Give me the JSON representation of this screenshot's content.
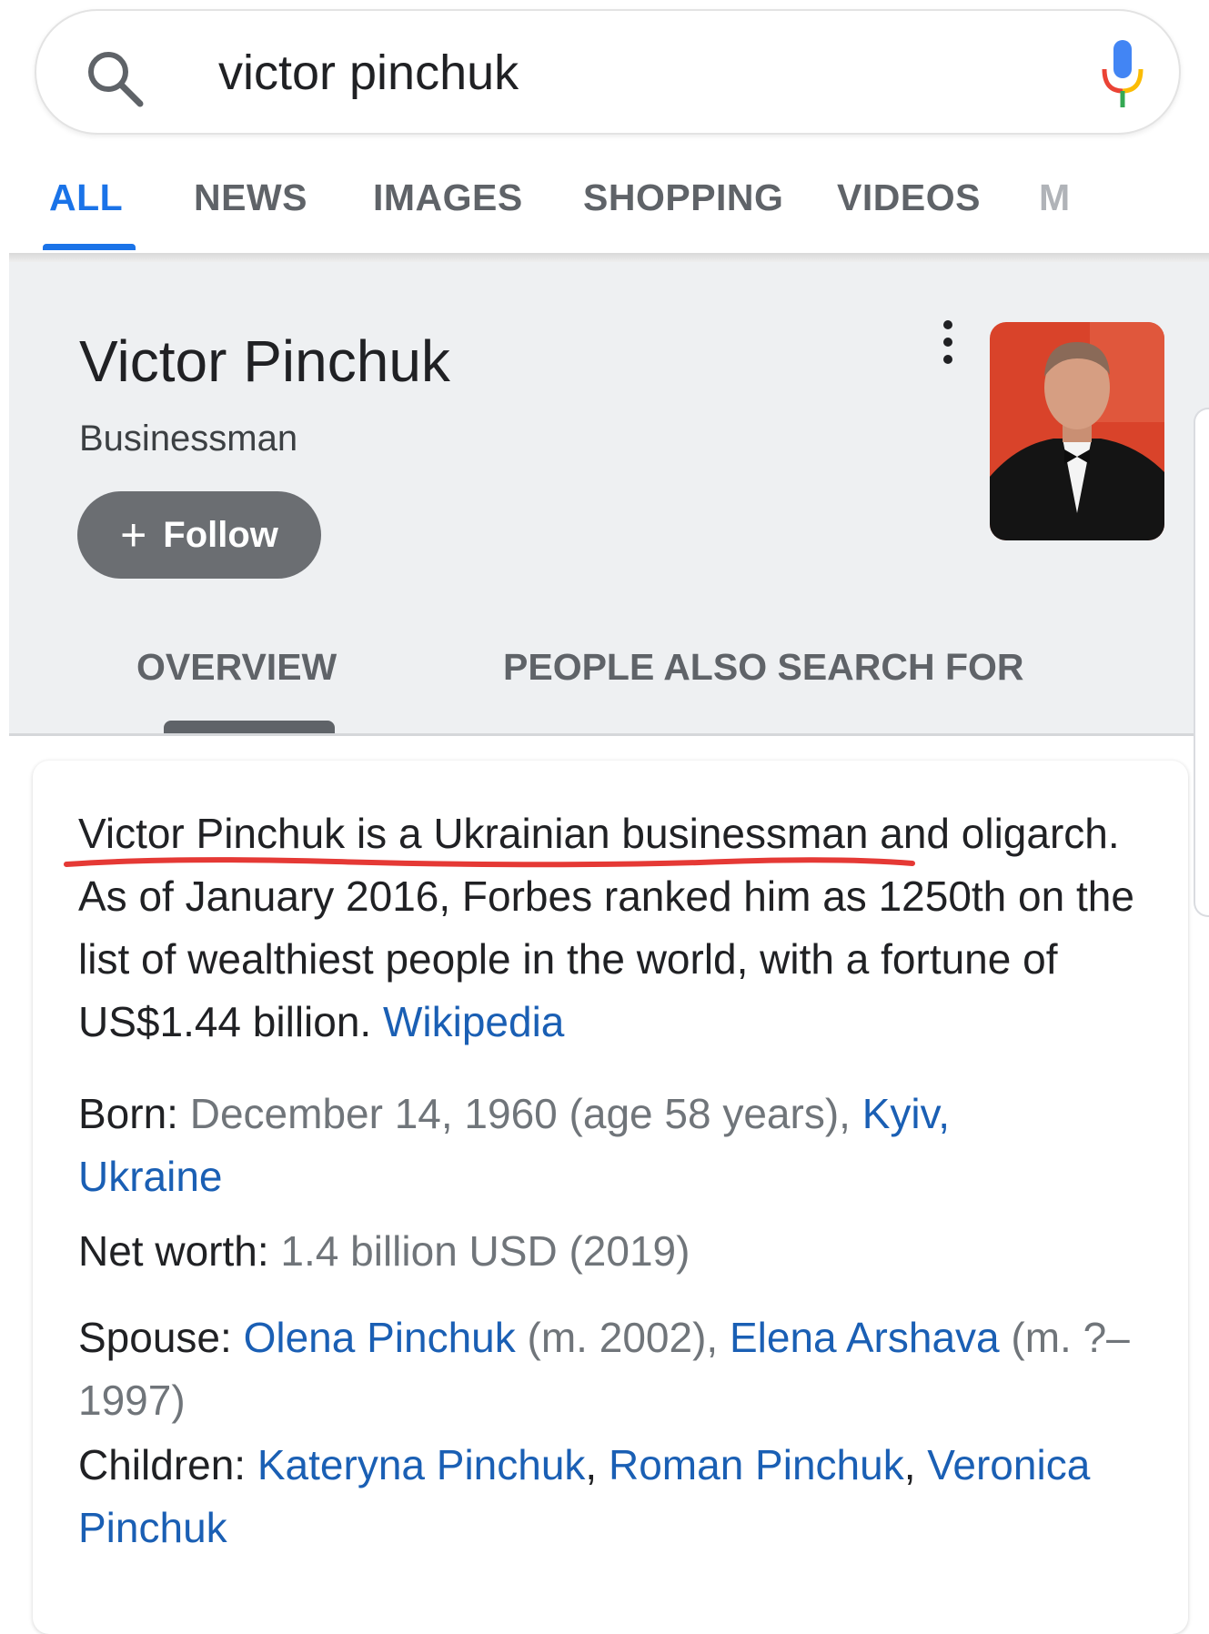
{
  "search": {
    "query": "victor pinchuk"
  },
  "tabs": [
    "ALL",
    "NEWS",
    "IMAGES",
    "SHOPPING",
    "VIDEOS",
    "M"
  ],
  "panel": {
    "title": "Victor Pinchuk",
    "subtitle": "Businessman",
    "follow_label": "Follow",
    "follow_plus": "+",
    "tabs": [
      "OVERVIEW",
      "PEOPLE ALSO SEARCH FOR"
    ]
  },
  "description": {
    "underlined": "Victor Pinchuk is a Ukrainian businessman",
    "text": " and oligarch. As of January 2016, Forbes ranked him as 1250th on the list of wealthiest people in the world, with a fortune of US$1.44 billion. ",
    "source": "Wikipedia"
  },
  "facts": {
    "born": {
      "label": "Born:",
      "value": " December 14, 1960 (age 58 years), ",
      "link1": "Kyiv,",
      "link2": "Ukraine"
    },
    "net_worth": {
      "label": "Net worth:",
      "value": " 1.4 billion USD (2019)"
    },
    "spouse": {
      "label": "Spouse:",
      "name1": "Olena Pinchuk",
      "meta1": " (m. 2002), ",
      "name2": "Elena Arshava",
      "meta2": " (m. ?–1997)"
    },
    "children": {
      "label": "Children:",
      "c1": "Kateryna Pinchuk",
      "sep1": ", ",
      "c2": "Roman Pinchuk",
      "sep2": ", ",
      "c3": "Veronica Pinchuk"
    }
  },
  "colors": {
    "accent": "#1a73e8",
    "link": "#1a5fb4",
    "highlight": "#e53935"
  }
}
